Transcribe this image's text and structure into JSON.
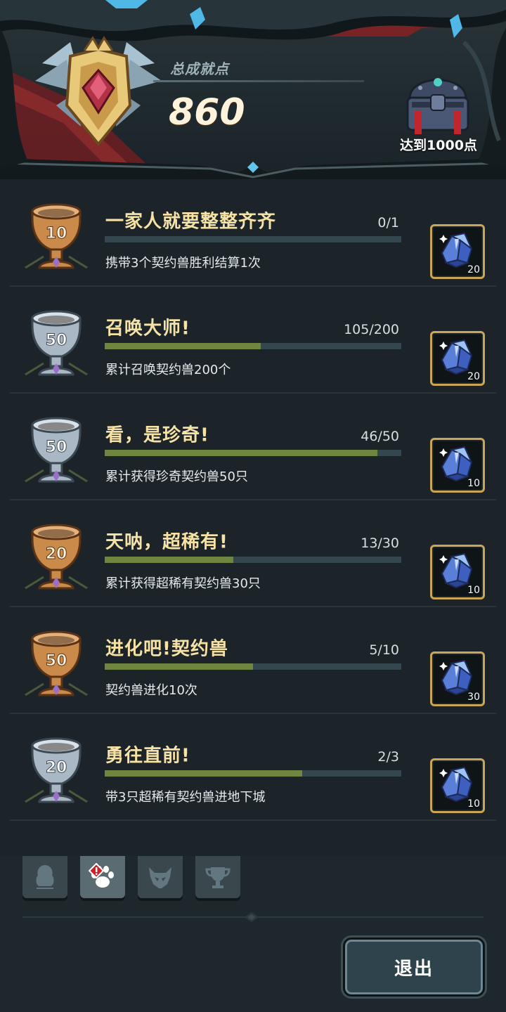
{
  "header": {
    "total_label": "总成就点",
    "total_points": "860",
    "chest_label": "达到1000点"
  },
  "achievements": [
    {
      "trophy_tier": "bronze",
      "trophy_number": "10",
      "title": "一家人就要整整齐齐",
      "progress_text": "0/1",
      "progress_fraction": 0.0,
      "description": "携带3个契约兽胜利结算1次",
      "reward_icon": "crystal-icon",
      "reward_count": "20"
    },
    {
      "trophy_tier": "silver",
      "trophy_number": "50",
      "title": "召唤大师!",
      "progress_text": "105/200",
      "progress_fraction": 0.525,
      "description": "累计召唤契约兽200个",
      "reward_icon": "crystal-icon",
      "reward_count": "20"
    },
    {
      "trophy_tier": "silver",
      "trophy_number": "50",
      "title": "看，是珍奇!",
      "progress_text": "46/50",
      "progress_fraction": 0.92,
      "description": "累计获得珍奇契约兽50只",
      "reward_icon": "crystal-icon",
      "reward_count": "10"
    },
    {
      "trophy_tier": "bronze",
      "trophy_number": "20",
      "title": "天呐，超稀有!",
      "progress_text": "13/30",
      "progress_fraction": 0.4333,
      "description": "累计获得超稀有契约兽30只",
      "reward_icon": "crystal-icon",
      "reward_count": "10"
    },
    {
      "trophy_tier": "bronze",
      "trophy_number": "50",
      "title": "进化吧!契约兽",
      "progress_text": "5/10",
      "progress_fraction": 0.5,
      "description": "契约兽进化10次",
      "reward_icon": "crystal-icon",
      "reward_count": "30"
    },
    {
      "trophy_tier": "silver",
      "trophy_number": "20",
      "title": "勇往直前!",
      "progress_text": "2/3",
      "progress_fraction": 0.6667,
      "description": "带3只超稀有契约兽进地下城",
      "reward_icon": "crystal-icon",
      "reward_count": "10"
    }
  ],
  "tabs": [
    {
      "icon": "character-silhouette-icon",
      "active": false
    },
    {
      "icon": "paw-icon",
      "active": true,
      "alert": true
    },
    {
      "icon": "monster-mask-icon",
      "active": false
    },
    {
      "icon": "trophy-icon",
      "active": false
    }
  ],
  "exit_label": "退出",
  "colors": {
    "title_gold": "#f6e2a4",
    "bar_fill": "#6f8640",
    "bar_track": "#34474f",
    "reward_border": "#c9a556",
    "alert_red": "#d0202a"
  }
}
